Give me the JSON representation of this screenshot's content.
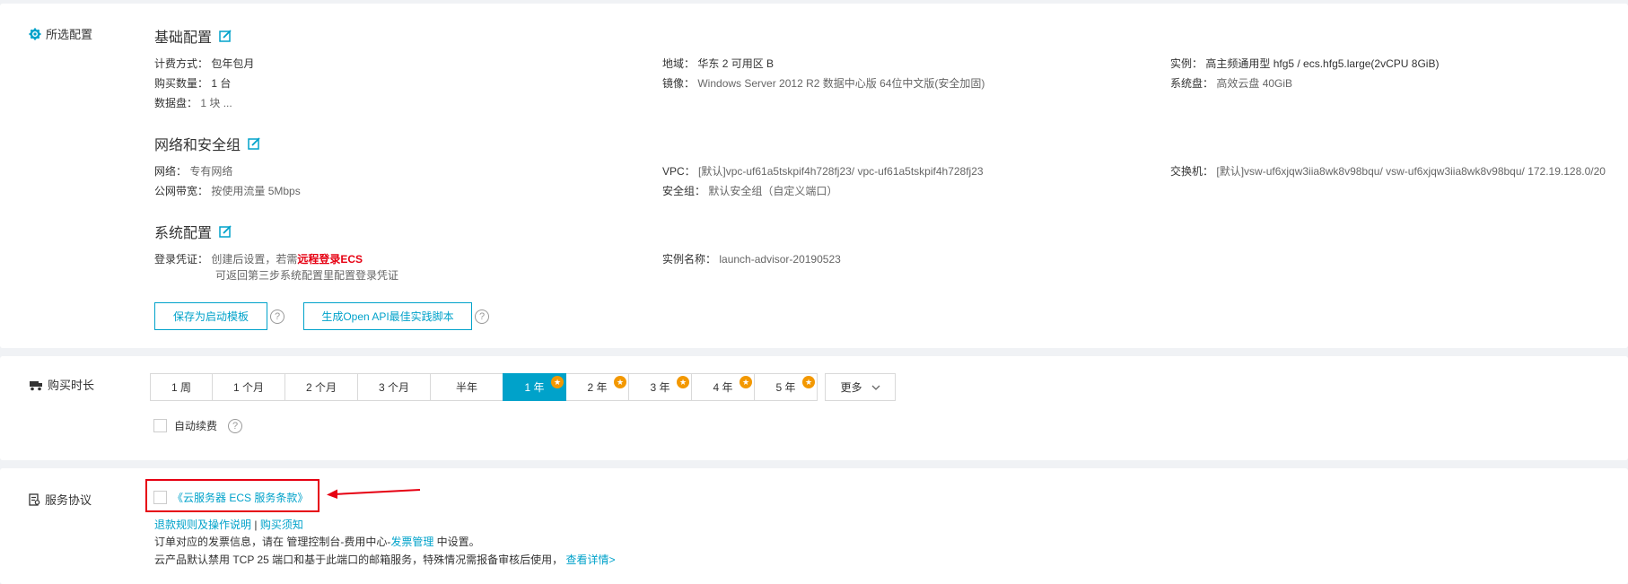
{
  "config": {
    "section_label": "所选配置",
    "basic": {
      "title": "基础配置",
      "billing": {
        "k": "计费方式：",
        "v": "包年包月"
      },
      "quantity": {
        "k": "购买数量：",
        "v": "1 台"
      },
      "datadisk": {
        "k": "数据盘：",
        "v": "1 块 ..."
      },
      "region": {
        "k": "地域：",
        "v": "华东 2 可用区 B"
      },
      "image": {
        "k": "镜像：",
        "v": "Windows Server 2012 R2 数据中心版 64位中文版(安全加固)"
      },
      "instance": {
        "k": "实例：",
        "v": "高主频通用型 hfg5 / ecs.hfg5.large(2vCPU 8GiB)"
      },
      "sysdisk": {
        "k": "系统盘：",
        "v": "高效云盘 40GiB"
      }
    },
    "network": {
      "title": "网络和安全组",
      "network": {
        "k": "网络：",
        "v": "专有网络"
      },
      "bandwidth": {
        "k": "公网带宽：",
        "v": "按使用流量 5Mbps"
      },
      "vpc": {
        "k": "VPC：",
        "v": "[默认]vpc-uf61a5tskpif4h728fj23/ vpc-uf61a5tskpif4h728fj23"
      },
      "secgroup": {
        "k": "安全组：",
        "v": "默认安全组（自定义端口）"
      },
      "vswitch": {
        "k": "交换机：",
        "v": "[默认]vsw-uf6xjqw3iia8wk8v98bqu/ vsw-uf6xjqw3iia8wk8v98bqu/ 172.19.128.0/20"
      }
    },
    "system": {
      "title": "系统配置",
      "login": {
        "k": "登录凭证：",
        "v1": "创建后设置，若需",
        "v1_red": "远程登录ECS",
        "v2": "可返回第三步系统配置里配置登录凭证"
      },
      "instance_name": {
        "k": "实例名称：",
        "v": "launch-advisor-20190523"
      }
    },
    "buttons": {
      "save_template": "保存为启动模板",
      "gen_api": "生成Open API最佳实践脚本"
    }
  },
  "duration": {
    "section_label": "购买时长",
    "options": [
      {
        "label": "1 周",
        "badge": false,
        "active": false
      },
      {
        "label": "1 个月",
        "badge": false,
        "active": false
      },
      {
        "label": "2 个月",
        "badge": false,
        "active": false
      },
      {
        "label": "3 个月",
        "badge": false,
        "active": false
      },
      {
        "label": "半年",
        "badge": false,
        "active": false
      },
      {
        "label": "1 年",
        "badge": true,
        "active": true
      },
      {
        "label": "2 年",
        "badge": true,
        "active": false
      },
      {
        "label": "3 年",
        "badge": true,
        "active": false
      },
      {
        "label": "4 年",
        "badge": true,
        "active": false
      },
      {
        "label": "5 年",
        "badge": true,
        "active": false
      }
    ],
    "more": "更多",
    "auto_renew": "自动续费"
  },
  "agreement": {
    "section_label": "服务协议",
    "terms_link": "《云服务器 ECS 服务条款》",
    "refund_link": "退款规则及操作说明",
    "separator": "|",
    "notice_link": "购买须知",
    "invoice_pre": "订单对应的发票信息，请在 管理控制台-费用中心-",
    "invoice_link": "发票管理",
    "invoice_post": " 中设置。",
    "port_text": "云产品默认禁用 TCP 25 端口和基于此端口的邮箱服务，特殊情况需报备审核后使用，",
    "port_link": "查看详情>"
  },
  "colors": {
    "accent": "#00a2ca",
    "warning_red": "#e60012",
    "badge_orange": "#f39800"
  }
}
